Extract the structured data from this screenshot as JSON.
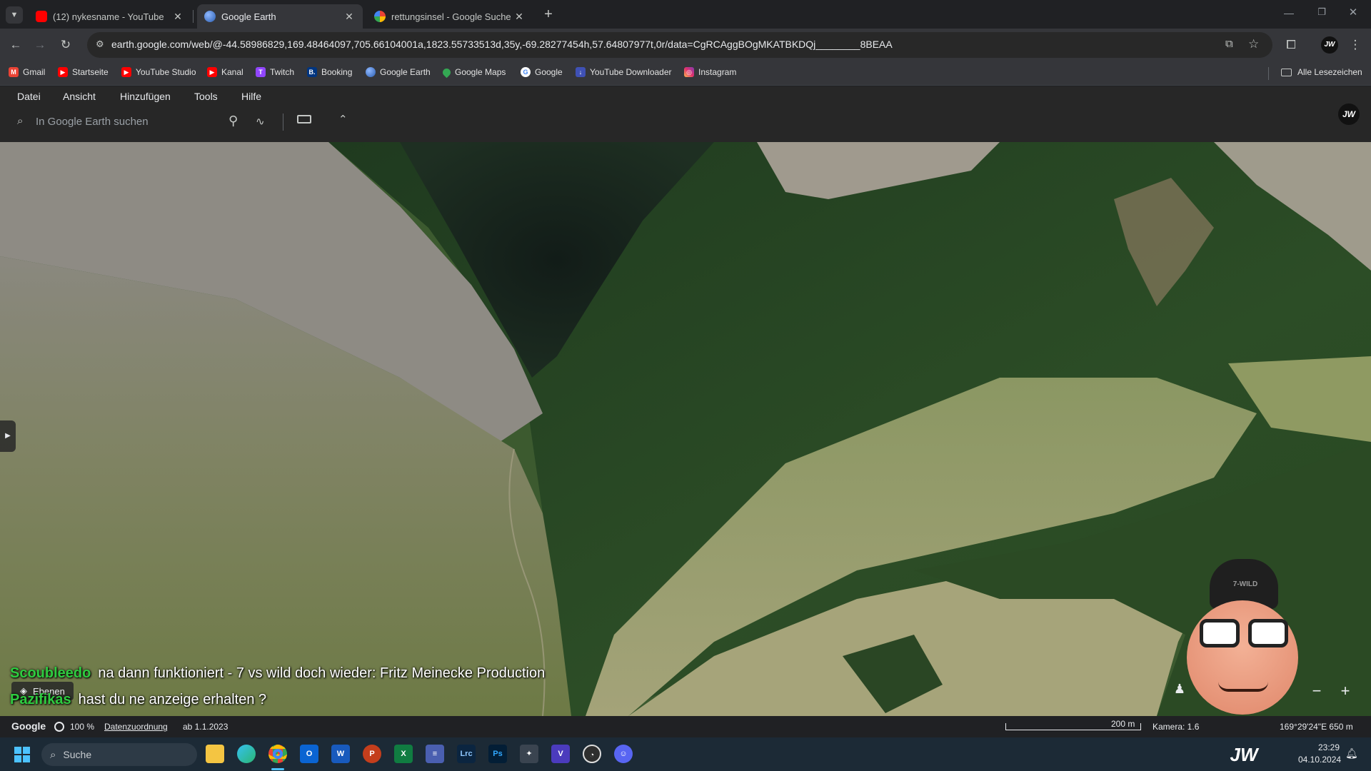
{
  "tabs": [
    {
      "label": "(12) nykesname - YouTube",
      "favicon_color": "#ff0000",
      "active": false
    },
    {
      "label": "Google Earth",
      "favicon_color": "#4a86e8",
      "active": true
    },
    {
      "label": "rettungsinsel - Google Suche",
      "favicon_color": "#ffffff",
      "active": false
    }
  ],
  "toolbar": {
    "url": "earth.google.com/web/@-44.58986829,169.48464097,705.66104001a,1823.55733513d,35y,-69.28277454h,57.64807977t,0r/data=CgRCAggBOgMKATBKDQj________8BEAA"
  },
  "bookmarks": [
    {
      "label": "Gmail",
      "icon": "gmail-icon",
      "color": "#ea4335",
      "glyph": "M"
    },
    {
      "label": "Startseite",
      "icon": "youtube-icon",
      "color": "#ff0000",
      "glyph": "▶"
    },
    {
      "label": "YouTube Studio",
      "icon": "youtube-icon",
      "color": "#ff0000",
      "glyph": "▶"
    },
    {
      "label": "Kanal",
      "icon": "youtube-icon",
      "color": "#ff0000",
      "glyph": "▶"
    },
    {
      "label": "Twitch",
      "icon": "twitch-icon",
      "color": "#9146ff",
      "glyph": "T"
    },
    {
      "label": "Booking",
      "icon": "booking-icon",
      "color": "#003580",
      "glyph": "B."
    },
    {
      "label": "Google Earth",
      "icon": "earth-icon",
      "color": "#4a86e8",
      "glyph": ""
    },
    {
      "label": "Google Maps",
      "icon": "maps-pin-icon",
      "color": "#34a853",
      "glyph": ""
    },
    {
      "label": "Google",
      "icon": "google-icon",
      "color": "#ffffff",
      "glyph": "G"
    },
    {
      "label": "YouTube Downloader",
      "icon": "downloader-icon",
      "color": "#3f51b5",
      "glyph": "↓"
    },
    {
      "label": "Instagram",
      "icon": "instagram-icon",
      "color": "#e1306c",
      "glyph": "◎"
    }
  ],
  "bookmarks_all": "Alle Lesezeichen",
  "menu": [
    "Datei",
    "Ansicht",
    "Hinzufügen",
    "Tools",
    "Hilfe"
  ],
  "search": {
    "placeholder": "In Google Earth suchen"
  },
  "chat": [
    {
      "user": "Scoubleedo",
      "message": "na dann funktioniert - 7 vs wild doch wieder: Fritz Meinecke Production"
    },
    {
      "user": "Pazifikas",
      "message": "hast du ne anzeige erhalten ?"
    }
  ],
  "layers_label": "Ebenen",
  "status": {
    "brand": "Google",
    "load": "100 %",
    "attribution": "Datenzuordnung",
    "date": "ab 1.1.2023",
    "scale": "200 m",
    "camera": "Kamera: 1.6",
    "coords": "169°29'24\"E  650 m"
  },
  "taskbar": {
    "search_placeholder": "Suche",
    "time": "23:29",
    "date": "04.10.2024"
  },
  "avatar_hat_text": "7-WILD",
  "logo_text": "JW"
}
